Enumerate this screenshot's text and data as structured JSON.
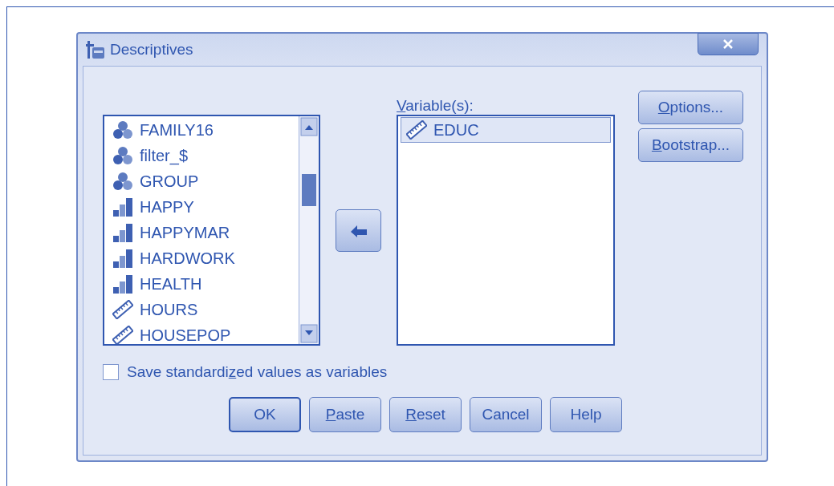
{
  "window": {
    "title": "Descriptives"
  },
  "source_list": {
    "items": [
      {
        "label": "FAMILY16",
        "kind": "nominal",
        "selected": false
      },
      {
        "label": "filter_$",
        "kind": "nominal",
        "selected": false
      },
      {
        "label": "GROUP",
        "kind": "nominal",
        "selected": false
      },
      {
        "label": "HAPPY",
        "kind": "ordinal",
        "selected": false
      },
      {
        "label": "HAPPYMAR",
        "kind": "ordinal",
        "selected": false
      },
      {
        "label": "HARDWORK",
        "kind": "ordinal",
        "selected": false
      },
      {
        "label": "HEALTH",
        "kind": "ordinal",
        "selected": false
      },
      {
        "label": "HOURS",
        "kind": "scale",
        "selected": false
      },
      {
        "label": "HOUSEPOP",
        "kind": "scale",
        "selected": false
      }
    ]
  },
  "target_list": {
    "mnemonic": "V",
    "label_end": "ariable(s):",
    "items": [
      {
        "label": "EDUC",
        "kind": "scale",
        "selected": true
      }
    ]
  },
  "side_buttons": [
    {
      "mnemonic": "O",
      "label_end": "ptions..."
    },
    {
      "mnemonic": "B",
      "label_end": "ootstrap..."
    }
  ],
  "checkbox": {
    "label_start": "Save standardi",
    "mnemonic": "z",
    "label_end": "ed values as variables",
    "checked": false
  },
  "buttons": [
    {
      "label_start": "OK",
      "default": true
    },
    {
      "mnemonic": "P",
      "label_end": "aste",
      "default": false
    },
    {
      "mnemonic": "R",
      "label_end": "eset",
      "default": false
    },
    {
      "label_start": "Cancel",
      "default": false
    },
    {
      "label_start": "Help",
      "default": false
    }
  ]
}
